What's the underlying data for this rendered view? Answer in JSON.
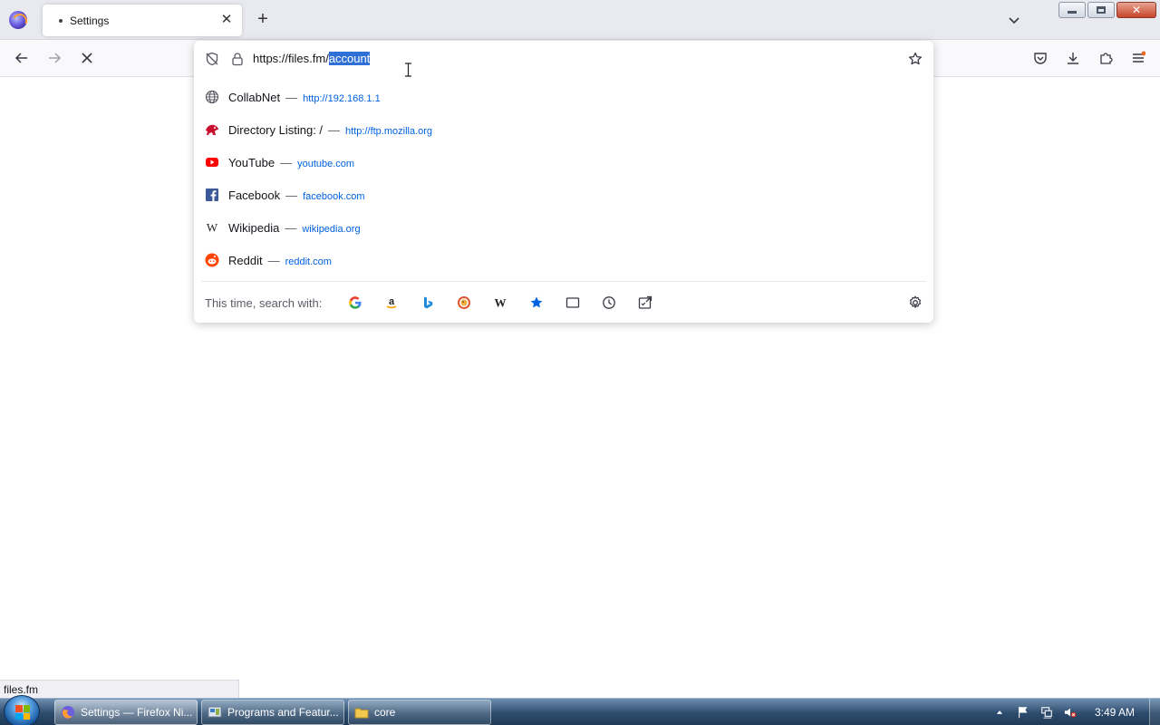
{
  "tab": {
    "title": "Settings",
    "close_glyph": "✕"
  },
  "toolbar": {
    "new_tab_glyph": "+"
  },
  "window": {
    "close_glyph": "✕"
  },
  "urlbar": {
    "url_prefix": "https://files.fm/",
    "url_selected": "account"
  },
  "results": [
    {
      "title": "CollabNet",
      "separator": "—",
      "url": "http://192.168.1.1",
      "icon": "globe-icon"
    },
    {
      "title": "Directory Listing: /",
      "separator": "—",
      "url": "http://ftp.mozilla.org",
      "icon": "mozilla-dino-icon"
    },
    {
      "title": "YouTube",
      "separator": "—",
      "url": "youtube.com",
      "icon": "youtube-icon"
    },
    {
      "title": "Facebook",
      "separator": "—",
      "url": "facebook.com",
      "icon": "facebook-icon"
    },
    {
      "title": "Wikipedia",
      "separator": "—",
      "url": "wikipedia.org",
      "icon": "wikipedia-icon"
    },
    {
      "title": "Reddit",
      "separator": "—",
      "url": "reddit.com",
      "icon": "reddit-icon"
    }
  ],
  "search": {
    "label": "This time, search with:",
    "engines": [
      "google-icon",
      "amazon-icon",
      "bing-icon",
      "duckduckgo-icon",
      "wikipedia-icon",
      "bookmarks-icon",
      "tabs-icon",
      "history-icon",
      "actions-icon"
    ]
  },
  "status": {
    "text": "files.fm"
  },
  "taskbar": {
    "tasks": [
      {
        "label": "Settings — Firefox Ni..."
      },
      {
        "label": "Programs and Featur..."
      },
      {
        "label": "core"
      }
    ],
    "clock": "3:49 AM"
  },
  "colors": {
    "selection": "#2f6fd8",
    "link": "#0061e0"
  }
}
